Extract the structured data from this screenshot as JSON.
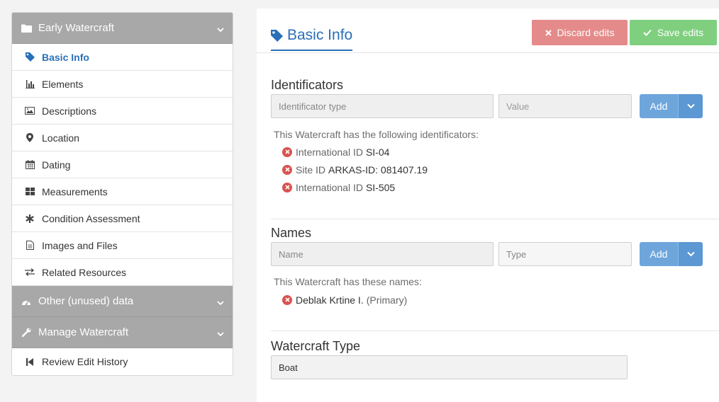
{
  "sidebar": {
    "section_main": {
      "label": "Early Watercraft"
    },
    "items": [
      {
        "label": "Basic Info",
        "icon": "tag-icon"
      },
      {
        "label": "Elements",
        "icon": "bar-chart-icon"
      },
      {
        "label": "Descriptions",
        "icon": "image-icon"
      },
      {
        "label": "Location",
        "icon": "map-marker-icon"
      },
      {
        "label": "Dating",
        "icon": "calendar-icon"
      },
      {
        "label": "Measurements",
        "icon": "grid-icon"
      },
      {
        "label": "Condition Assessment",
        "icon": "asterisk-icon"
      },
      {
        "label": "Images and Files",
        "icon": "file-icon"
      },
      {
        "label": "Related Resources",
        "icon": "exchange-icon"
      }
    ],
    "section_other": {
      "label": "Other (unused) data"
    },
    "section_manage": {
      "label": "Manage Watercraft"
    },
    "review": {
      "label": "Review Edit History"
    }
  },
  "main": {
    "tab": {
      "label": "Basic Info"
    },
    "discard_label": "Discard edits",
    "save_label": "Save edits",
    "identificators": {
      "title": "Identificators",
      "type_placeholder": "Identificator type",
      "value_placeholder": "Value",
      "add_label": "Add",
      "info": "This Watercraft has the following identificators:",
      "items": [
        {
          "label": "International ID",
          "value": "SI-04"
        },
        {
          "label": "Site ID",
          "value": "ARKAS-ID: 081407.19"
        },
        {
          "label": "International ID",
          "value": "SI-505"
        }
      ]
    },
    "names": {
      "title": "Names",
      "name_placeholder": "Name",
      "type_placeholder": "Type",
      "add_label": "Add",
      "info": "This Watercraft has these names:",
      "items": [
        {
          "value": "Deblak Krtine I.",
          "tag": "(Primary)"
        }
      ]
    },
    "watercraft_type": {
      "title": "Watercraft Type",
      "value": "Boat"
    }
  },
  "colors": {
    "accent": "#2a6fb8",
    "sidebar_section": "#a8a8a8",
    "discard": "#e58a8a",
    "save": "#7fcf7f",
    "add": "#6ea6dc",
    "remove": "#d9534f"
  }
}
